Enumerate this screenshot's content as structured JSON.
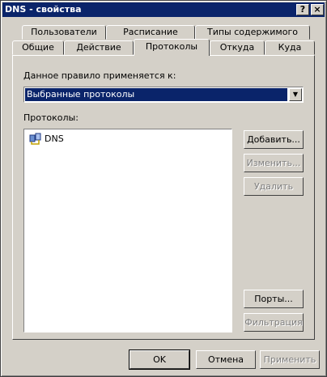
{
  "window": {
    "title": "DNS - свойства",
    "help_label": "?",
    "close_label": "×"
  },
  "tabs": {
    "row1": [
      "Пользователи",
      "Расписание",
      "Типы содержимого"
    ],
    "row2": [
      "Общие",
      "Действие",
      "Протоколы",
      "Откуда",
      "Куда"
    ],
    "active": "Протоколы"
  },
  "rule": {
    "label": "Данное правило применяется к:",
    "selected": "Выбранные протоколы"
  },
  "protocols": {
    "label": "Протоколы:",
    "items": [
      {
        "name": "DNS",
        "icon": "protocol-icon"
      }
    ]
  },
  "side_buttons": {
    "add": "Добавить...",
    "edit": "Изменить...",
    "delete": "Удалить",
    "ports": "Порты...",
    "filter": "Фильтрация"
  },
  "footer": {
    "ok": "OK",
    "cancel": "Отмена",
    "apply": "Применить"
  },
  "colors": {
    "titlebar": "#0a246a",
    "face": "#d4d0c8",
    "selection": "#0a246a"
  }
}
